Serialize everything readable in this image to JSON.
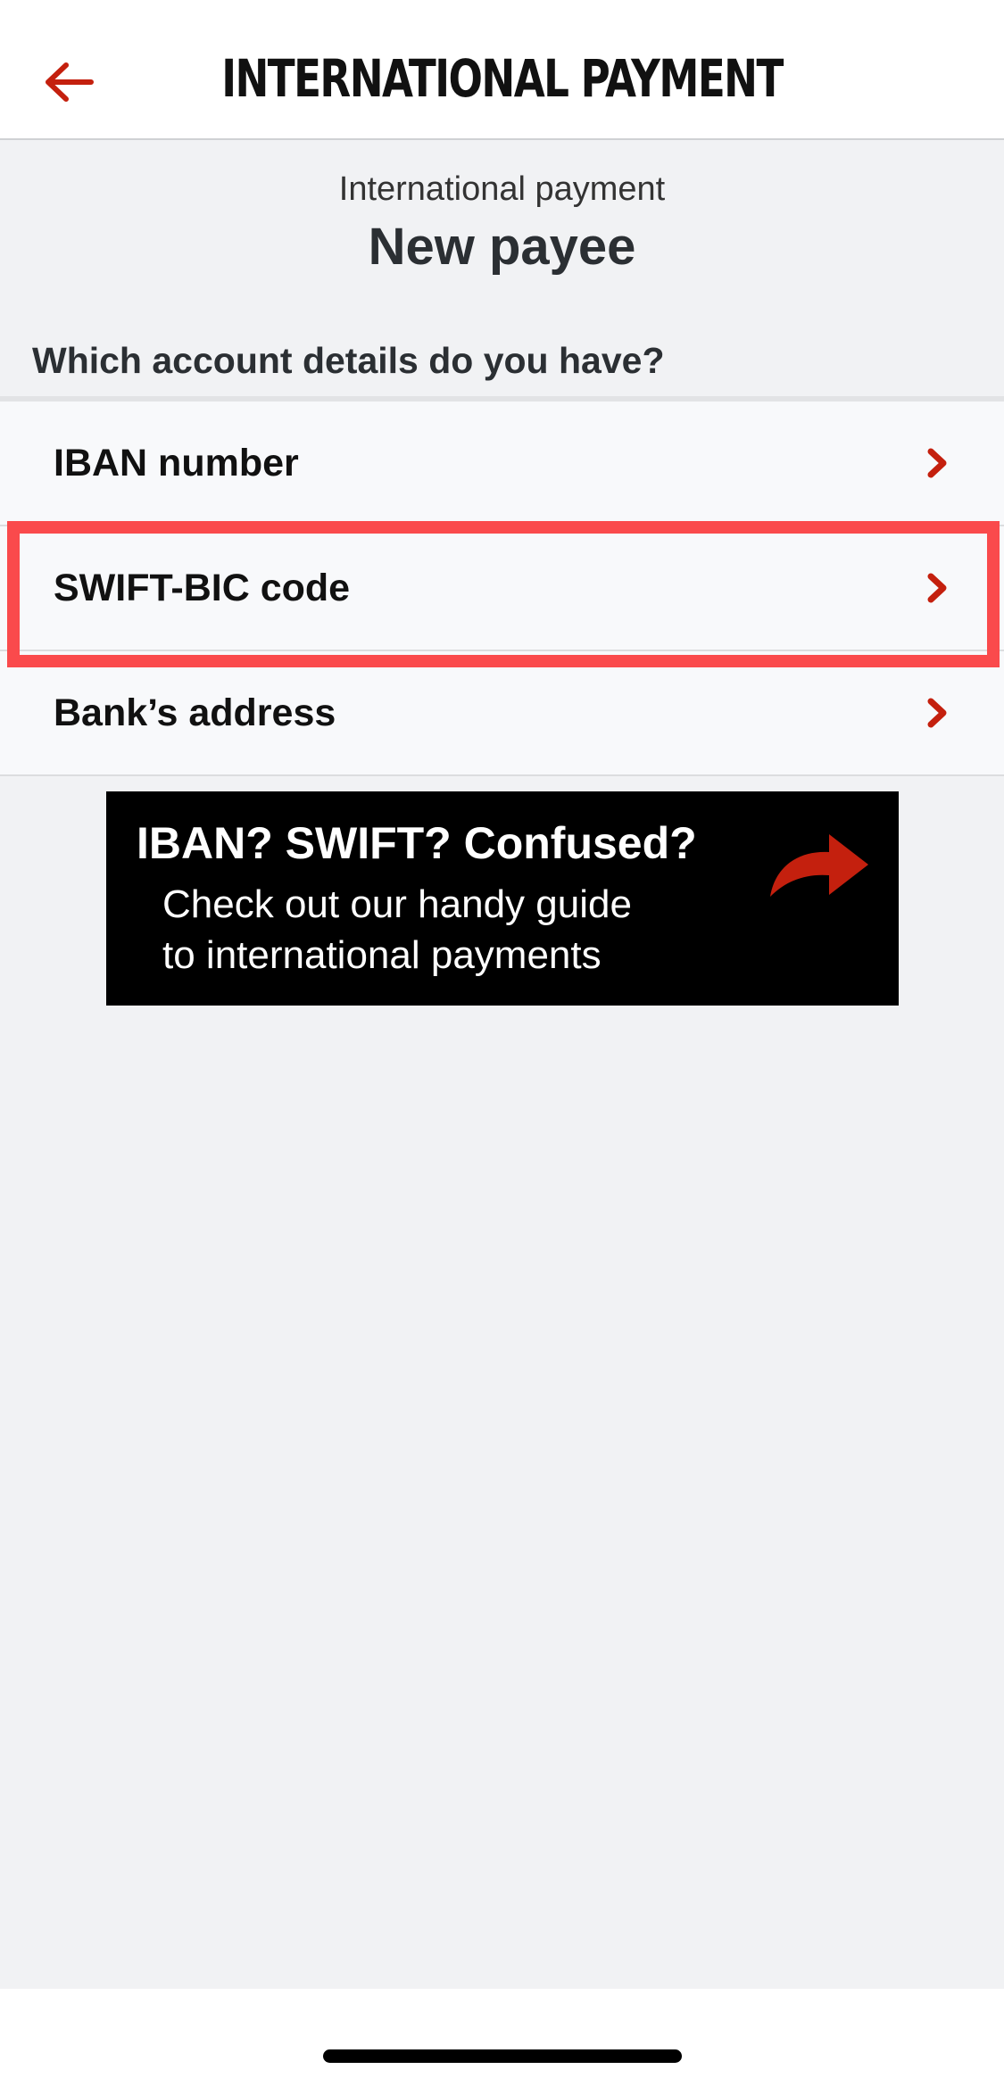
{
  "header": {
    "title": "INTERNATIONAL PAYMENT",
    "back_icon": "arrow-left-icon",
    "accent_color": "#c4200e"
  },
  "subheader": {
    "small": "International payment",
    "big": "New payee"
  },
  "question": "Which account details do you have?",
  "options": [
    {
      "label": "IBAN number",
      "icon": "chevron-right-icon"
    },
    {
      "label": "SWIFT-BIC code",
      "icon": "chevron-right-icon",
      "highlighted": true
    },
    {
      "label": "Bank’s address",
      "icon": "chevron-right-icon"
    }
  ],
  "highlight_color": "#fa4a4c",
  "banner": {
    "headline": "IBAN? SWIFT? Confused?",
    "line1": "Check out our handy guide",
    "line2": "to international payments",
    "icon": "curved-arrow-icon"
  }
}
